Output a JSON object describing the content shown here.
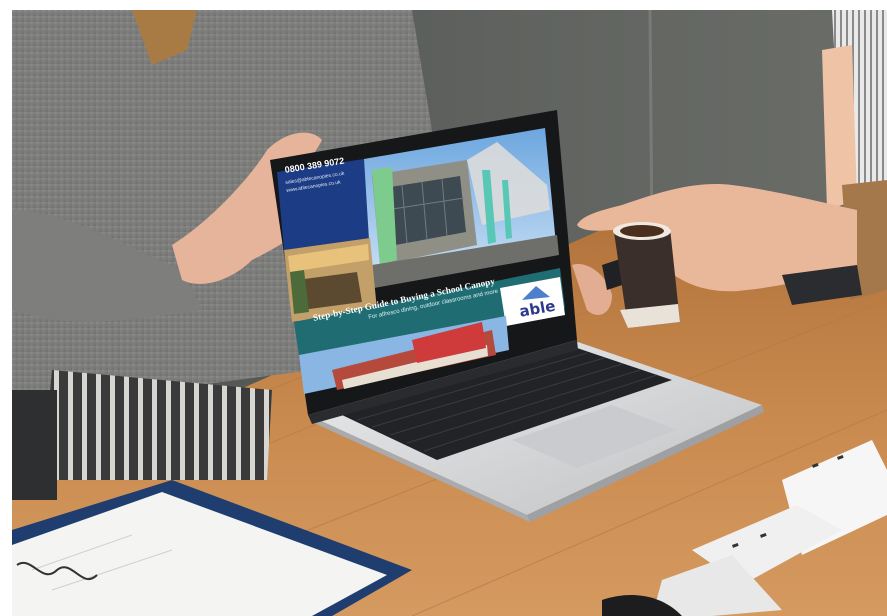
{
  "brochure": {
    "phone": "0800 389 9072",
    "email": "sales@ablecanopies.co.uk",
    "website": "www.ablecanopies.co.uk",
    "title": "Step-by-Step Guide to Buying a School Canopy",
    "subtitle": "For alfresco dining, outdoor classrooms and more",
    "logo": "able"
  },
  "colors": {
    "teal_band": "#1f6d73",
    "navy_panel": "#1d3c86",
    "wood_table": "#c8864b",
    "wall": "#5b5d5a",
    "laptop_silver": "#d9dadc"
  }
}
